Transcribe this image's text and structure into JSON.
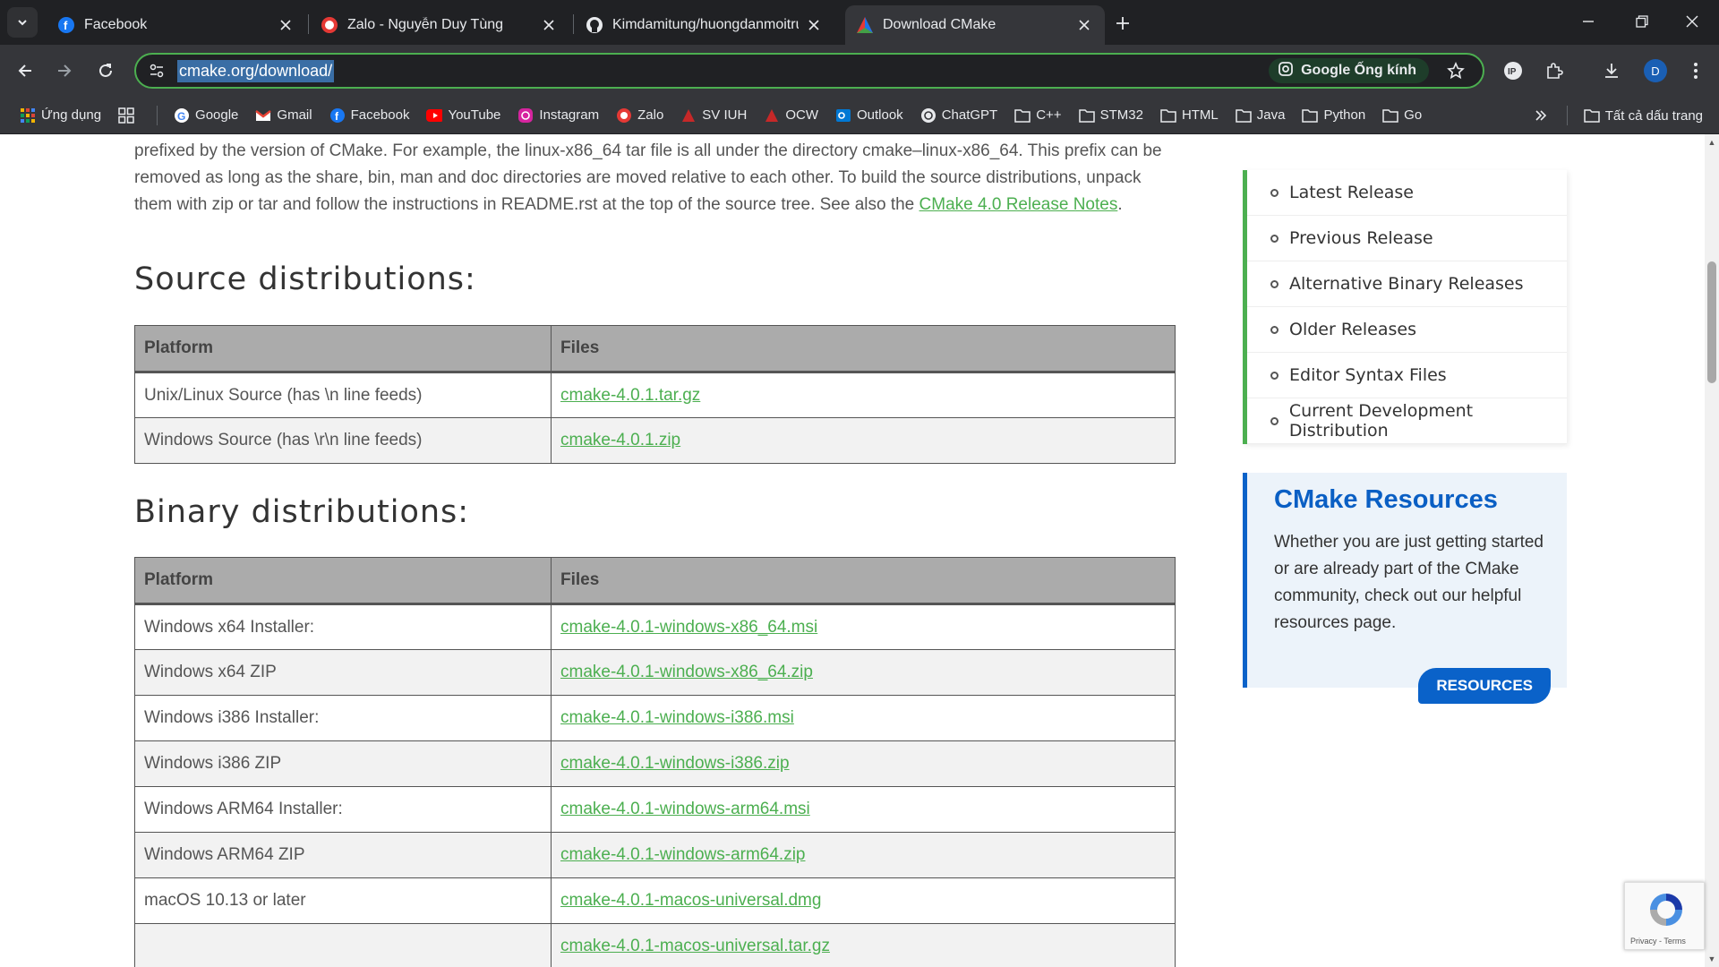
{
  "tabs": [
    {
      "title": "Facebook",
      "favicon": "facebook-icon"
    },
    {
      "title": "Zalo - Nguyễn Duy Tùng",
      "favicon": "zalo-icon"
    },
    {
      "title": "Kimdamitung/huongdanmoitru",
      "favicon": "github-icon"
    },
    {
      "title": "Download CMake",
      "favicon": "cmake-icon",
      "active": true
    }
  ],
  "omnibox": {
    "url": "cmake.org/download/",
    "lens_label": "Google Ống kính"
  },
  "profile": {
    "initial": "D"
  },
  "bookmarks": {
    "apps_label": "Ứng dụng",
    "items": [
      {
        "label": "Google",
        "icon": "google-icon"
      },
      {
        "label": "Gmail",
        "icon": "gmail-icon"
      },
      {
        "label": "Facebook",
        "icon": "facebook-icon"
      },
      {
        "label": "YouTube",
        "icon": "youtube-icon"
      },
      {
        "label": "Instagram",
        "icon": "instagram-icon"
      },
      {
        "label": "Zalo",
        "icon": "zalo-icon"
      },
      {
        "label": "SV IUH",
        "icon": "iuh-icon"
      },
      {
        "label": "OCW",
        "icon": "iuh-icon"
      },
      {
        "label": "Outlook",
        "icon": "outlook-icon"
      },
      {
        "label": "ChatGPT",
        "icon": "chatgpt-icon"
      },
      {
        "label": "C++",
        "icon": "folder-icon"
      },
      {
        "label": "STM32",
        "icon": "folder-icon"
      },
      {
        "label": "HTML",
        "icon": "folder-icon"
      },
      {
        "label": "Java",
        "icon": "folder-icon"
      },
      {
        "label": "Python",
        "icon": "folder-icon"
      },
      {
        "label": "Go",
        "icon": "folder-icon"
      }
    ],
    "all_bookmarks_label": "Tất cả dấu trang"
  },
  "content": {
    "intro_text": "prefixed by the version of CMake. For example, the linux-x86_64 tar file is all under the directory cmake–linux-x86_64. This prefix can be removed as long as the share, bin, man and doc directories are moved relative to each other. To build the source distributions, unpack them with zip or tar and follow the instructions in README.rst at the top of the source tree. See also the ",
    "release_notes_link": "CMake 4.0 Release Notes",
    "intro_end": ".",
    "source_heading": "Source distributions:",
    "binary_heading": "Binary distributions:",
    "col_platform": "Platform",
    "col_files": "Files",
    "source_rows": [
      {
        "platform": "Unix/Linux Source (has \\n line feeds)",
        "file": "cmake-4.0.1.tar.gz"
      },
      {
        "platform": "Windows Source (has \\r\\n line feeds)",
        "file": "cmake-4.0.1.zip"
      }
    ],
    "binary_rows": [
      {
        "platform": "Windows x64 Installer:",
        "file": "cmake-4.0.1-windows-x86_64.msi"
      },
      {
        "platform": "Windows x64 ZIP",
        "file": "cmake-4.0.1-windows-x86_64.zip"
      },
      {
        "platform": "Windows i386 Installer:",
        "file": "cmake-4.0.1-windows-i386.msi"
      },
      {
        "platform": "Windows i386 ZIP",
        "file": "cmake-4.0.1-windows-i386.zip"
      },
      {
        "platform": "Windows ARM64 Installer:",
        "file": "cmake-4.0.1-windows-arm64.msi"
      },
      {
        "platform": "Windows ARM64 ZIP",
        "file": "cmake-4.0.1-windows-arm64.zip"
      },
      {
        "platform": "macOS 10.13 or later",
        "file": "cmake-4.0.1-macos-universal.dmg"
      },
      {
        "platform": "",
        "file": "cmake-4.0.1-macos-universal.tar.gz"
      }
    ]
  },
  "sidebar": {
    "items": [
      "Latest Release",
      "Previous Release",
      "Alternative Binary Releases",
      "Older Releases",
      "Editor Syntax Files",
      "Current Development Distribution"
    ]
  },
  "resources": {
    "title": "CMake Resources",
    "text": "Whether you are just getting started or are already part of the CMake community, check out our helpful resources page.",
    "button": "RESOURCES"
  },
  "recaptcha": {
    "text": "Privacy - Terms"
  },
  "colors": {
    "link_green": "#4caf50",
    "resources_blue": "#0a62c9",
    "chrome_dark": "#202124"
  }
}
